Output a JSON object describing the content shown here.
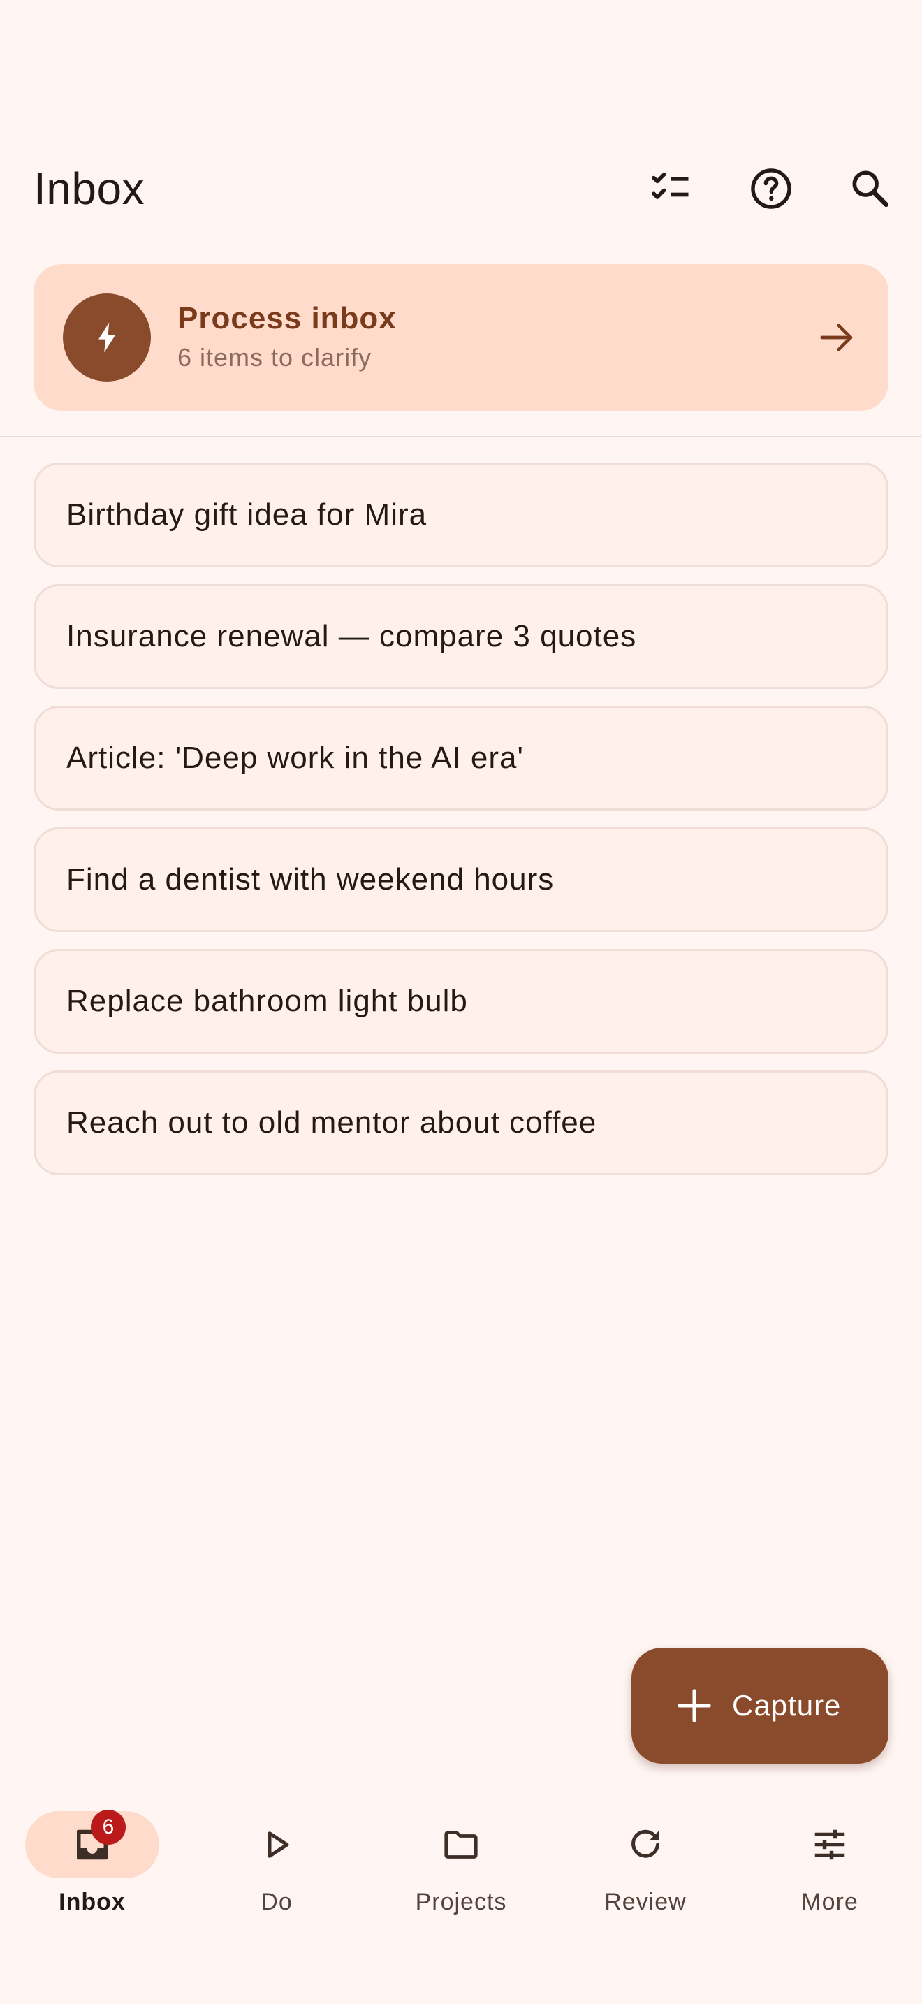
{
  "header": {
    "title": "Inbox",
    "actions": [
      {
        "icon": "checklist-icon"
      },
      {
        "icon": "help-icon"
      },
      {
        "icon": "search-icon"
      }
    ]
  },
  "process_card": {
    "title": "Process inbox",
    "subtitle": "6 items to clarify",
    "icon": "bolt-icon",
    "trailing_icon": "arrow-right-icon"
  },
  "inbox_items": [
    "Birthday gift idea for Mira",
    "Insurance renewal — compare 3 quotes",
    "Article: 'Deep work in the AI era'",
    "Find a dentist with weekend hours",
    "Replace bathroom light bulb",
    "Reach out to old mentor about coffee"
  ],
  "fab": {
    "label": "Capture",
    "icon": "plus-icon"
  },
  "bottom_nav": {
    "items": [
      {
        "label": "Inbox",
        "icon": "inbox-icon",
        "badge": "6",
        "active": true
      },
      {
        "label": "Do",
        "icon": "play-icon",
        "active": false
      },
      {
        "label": "Projects",
        "icon": "folder-icon",
        "active": false
      },
      {
        "label": "Review",
        "icon": "refresh-icon",
        "active": false
      },
      {
        "label": "More",
        "icon": "tune-icon",
        "active": false
      }
    ]
  },
  "colors": {
    "background": "#fff6f3",
    "accent": "#8a4b2c",
    "card": "#ffdbcc",
    "badge": "#ba1a1a"
  }
}
